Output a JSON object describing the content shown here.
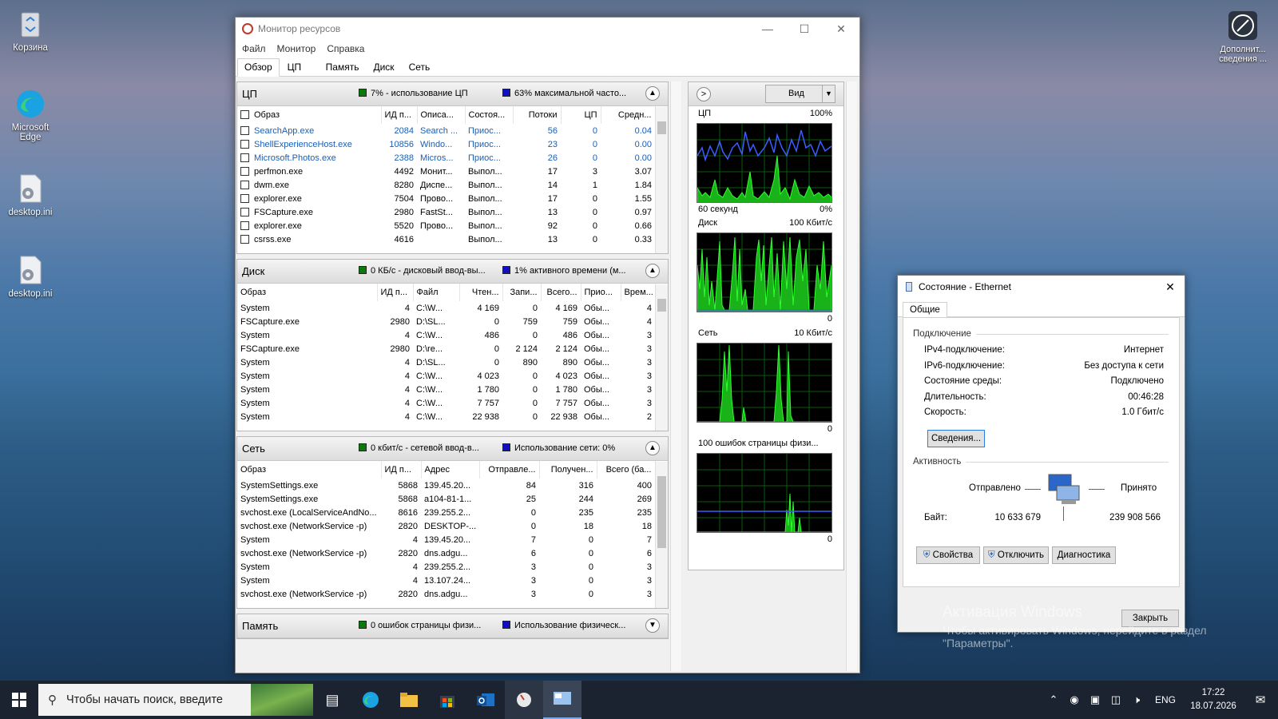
{
  "desktop": {
    "icons": [
      {
        "label": "Корзина",
        "icon": "recycle-bin-icon"
      },
      {
        "label": "Microsoft Edge",
        "icon": "edge-icon"
      },
      {
        "label": "desktop.ini",
        "icon": "settings-file-icon"
      },
      {
        "label": "desktop.ini",
        "icon": "settings-file-icon"
      }
    ],
    "corner_icon_label": "Дополнит... сведения ..."
  },
  "resmon": {
    "title": "Монитор ресурсов",
    "menu": [
      "Файл",
      "Монитор",
      "Справка"
    ],
    "tabs": [
      "Обзор",
      "ЦП",
      "Память",
      "Диск",
      "Сеть"
    ],
    "active_tab": "Обзор",
    "cpu": {
      "name": "ЦП",
      "ind1": "7% - использование ЦП",
      "ind2": "63% максимальной часто...",
      "columns": [
        "Образ",
        "ИД п...",
        "Описа...",
        "Состоя...",
        "Потоки",
        "ЦП",
        "Средн..."
      ],
      "rows": [
        [
          "SearchApp.exe",
          "2084",
          "Search ...",
          "Приос...",
          "56",
          "0",
          "0.04"
        ],
        [
          "ShellExperienceHost.exe",
          "10856",
          "Windo...",
          "Приос...",
          "23",
          "0",
          "0.00"
        ],
        [
          "Microsoft.Photos.exe",
          "2388",
          "Micros...",
          "Приос...",
          "26",
          "0",
          "0.00"
        ],
        [
          "perfmon.exe",
          "4492",
          "Монит...",
          "Выпол...",
          "17",
          "3",
          "3.07"
        ],
        [
          "dwm.exe",
          "8280",
          "Диспе...",
          "Выпол...",
          "14",
          "1",
          "1.84"
        ],
        [
          "explorer.exe",
          "7504",
          "Прово...",
          "Выпол...",
          "17",
          "0",
          "1.55"
        ],
        [
          "FSCapture.exe",
          "2980",
          "FastSt...",
          "Выпол...",
          "13",
          "0",
          "0.97"
        ],
        [
          "explorer.exe",
          "5520",
          "Прово...",
          "Выпол...",
          "92",
          "0",
          "0.66"
        ],
        [
          "csrss.exe",
          "4616",
          "",
          "Выпол...",
          "13",
          "0",
          "0.33"
        ]
      ]
    },
    "disk": {
      "name": "Диск",
      "ind1": "0 КБ/с - дисковый ввод-вы...",
      "ind2": "1% активного времени (м...",
      "columns": [
        "Образ",
        "ИД п...",
        "Файл",
        "Чтен...",
        "Запи...",
        "Всего...",
        "Прио...",
        "Врем..."
      ],
      "rows": [
        [
          "System",
          "4",
          "C:\\W...",
          "4 169",
          "0",
          "4 169",
          "Обы...",
          "4"
        ],
        [
          "FSCapture.exe",
          "2980",
          "D:\\SL...",
          "0",
          "759",
          "759",
          "Обы...",
          "4"
        ],
        [
          "System",
          "4",
          "C:\\W...",
          "486",
          "0",
          "486",
          "Обы...",
          "3"
        ],
        [
          "FSCapture.exe",
          "2980",
          "D:\\re...",
          "0",
          "2 124",
          "2 124",
          "Обы...",
          "3"
        ],
        [
          "System",
          "4",
          "D:\\SL...",
          "0",
          "890",
          "890",
          "Обы...",
          "3"
        ],
        [
          "System",
          "4",
          "C:\\W...",
          "4 023",
          "0",
          "4 023",
          "Обы...",
          "3"
        ],
        [
          "System",
          "4",
          "C:\\W...",
          "1 780",
          "0",
          "1 780",
          "Обы...",
          "3"
        ],
        [
          "System",
          "4",
          "C:\\W...",
          "7 757",
          "0",
          "7 757",
          "Обы...",
          "3"
        ],
        [
          "System",
          "4",
          "C:\\W...",
          "22 938",
          "0",
          "22 938",
          "Обы...",
          "2"
        ]
      ]
    },
    "net": {
      "name": "Сеть",
      "ind1": "0 кбит/с - сетевой ввод-в...",
      "ind2": "Использование сети: 0%",
      "columns": [
        "Образ",
        "ИД п...",
        "Адрес",
        "Отправле...",
        "Получен...",
        "Всего (ба..."
      ],
      "rows": [
        [
          "SystemSettings.exe",
          "5868",
          "139.45.20...",
          "84",
          "316",
          "400"
        ],
        [
          "SystemSettings.exe",
          "5868",
          "a104-81-1...",
          "25",
          "244",
          "269"
        ],
        [
          "svchost.exe (LocalServiceAndNo...",
          "8616",
          "239.255.2...",
          "0",
          "235",
          "235"
        ],
        [
          "svchost.exe (NetworkService -p)",
          "2820",
          "DESKTOP-...",
          "0",
          "18",
          "18"
        ],
        [
          "System",
          "4",
          "139.45.20...",
          "7",
          "0",
          "7"
        ],
        [
          "svchost.exe (NetworkService -p)",
          "2820",
          "dns.adgu...",
          "6",
          "0",
          "6"
        ],
        [
          "System",
          "4",
          "239.255.2...",
          "3",
          "0",
          "3"
        ],
        [
          "System",
          "4",
          "13.107.24...",
          "3",
          "0",
          "3"
        ],
        [
          "svchost.exe (NetworkService -p)",
          "2820",
          "dns.adgu...",
          "3",
          "0",
          "3"
        ]
      ]
    },
    "memory": {
      "name": "Память",
      "ind1": "0 ошибок страницы физи...",
      "ind2": "Использование физическ..."
    },
    "graphs": {
      "view_label": "Вид",
      "cpu_label": "ЦП",
      "cpu_max": "100%",
      "cpu_time": "60 секунд",
      "cpu_min": "0%",
      "disk_label": "Диск",
      "disk_max": "100 Кбит/с",
      "disk_min": "0",
      "net_label": "Сеть",
      "net_max": "10 Кбит/с",
      "net_min": "0",
      "mem_label": "100 ошибок страницы физи...",
      "mem_min": "0"
    }
  },
  "ethernet": {
    "title": "Состояние - Ethernet",
    "tab": "Общие",
    "connection_header": "Подключение",
    "fields": [
      {
        "label": "IPv4-подключение:",
        "value": "Интернет"
      },
      {
        "label": "IPv6-подключение:",
        "value": "Без доступа к сети"
      },
      {
        "label": "Состояние среды:",
        "value": "Подключено"
      },
      {
        "label": "Длительность:",
        "value": "00:46:28"
      },
      {
        "label": "Скорость:",
        "value": "1.0 Гбит/с"
      }
    ],
    "details_button": "Сведения...",
    "activity_header": "Активность",
    "sent_label": "Отправлено",
    "received_label": "Принято",
    "bytes_label": "Байт:",
    "bytes_sent": "10 633 679",
    "bytes_received": "239 908 566",
    "buttons": [
      "Свойства",
      "Отключить",
      "Диагностика"
    ],
    "close_button": "Закрыть"
  },
  "watermark": {
    "line1": "Активация Windows",
    "line2": "Чтобы активировать Windows, перейдите в раздел",
    "line3": "\"Параметры\"."
  },
  "taskbar": {
    "search_placeholder": "Чтобы начать поиск, введите",
    "language": "ENG",
    "time": "17:22",
    "date": "18.07.2026"
  },
  "colors": {
    "accent_green": "#0a7a0a",
    "accent_blue": "#1010c0",
    "link_blue": "#1a5fb4"
  }
}
